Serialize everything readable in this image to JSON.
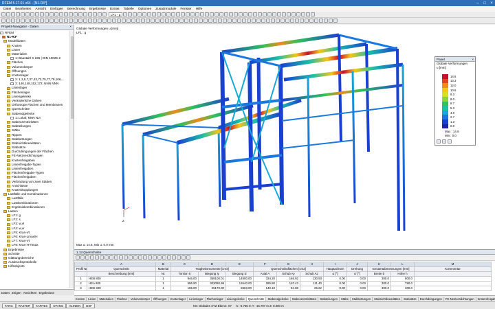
{
  "app": {
    "title": "RFEM 5.17.01 x64 - [N1-R3*]"
  },
  "menu": [
    "Datei",
    "Bearbeiten",
    "Ansicht",
    "Einfügen",
    "Berechnung",
    "Ergebnisse",
    "Extras",
    "Tabelle",
    "Optionen",
    "Zusatzmodule",
    "Fenster",
    "Hilfe"
  ],
  "toolbar": {
    "loadcase_combo": "LF1 - g"
  },
  "navigator": {
    "title": "Projekt-Navigator - Daten",
    "close": "×",
    "root": "RFEM",
    "model": "N1-R3*",
    "items": [
      {
        "label": "Modelldaten",
        "indent": 1,
        "icon": "folder"
      },
      {
        "label": "Knoten",
        "indent": 2,
        "icon": "folder"
      },
      {
        "label": "Linien",
        "indent": 2,
        "icon": "folder"
      },
      {
        "label": "Materialien",
        "indent": 2,
        "icon": "folder"
      },
      {
        "label": "1: Baustahl S 235 | DIN 10025-2",
        "indent": 3,
        "icon": "doc"
      },
      {
        "label": "Flächen",
        "indent": 2,
        "icon": "folder"
      },
      {
        "label": "Volumenkörper",
        "indent": 2,
        "icon": "folder"
      },
      {
        "label": "Öffnungen",
        "indent": 2,
        "icon": "folder"
      },
      {
        "label": "Knotenlager",
        "indent": 2,
        "icon": "folder"
      },
      {
        "label": "2: 1,3,5,7,37,43,73,75,77,79,106,...",
        "indent": 3,
        "icon": "doc"
      },
      {
        "label": "3: 146,148,152,172; NNN NNN",
        "indent": 3,
        "icon": "doc"
      },
      {
        "label": "Linienlager",
        "indent": 2,
        "icon": "folder"
      },
      {
        "label": "Flächenlager",
        "indent": 2,
        "icon": "folder"
      },
      {
        "label": "Liniengelenke",
        "indent": 2,
        "icon": "folder"
      },
      {
        "label": "Veränderliche Dicken",
        "indent": 2,
        "icon": "folder"
      },
      {
        "label": "Orthotrope Flächen und Membranen",
        "indent": 2,
        "icon": "folder"
      },
      {
        "label": "Querschnitte",
        "indent": 2,
        "icon": "folder"
      },
      {
        "label": "Stabendgelenke",
        "indent": 2,
        "icon": "folder"
      },
      {
        "label": "1: Lokal; NNN NJI",
        "indent": 3,
        "icon": "doc"
      },
      {
        "label": "Stabexzentrizitäten",
        "indent": 2,
        "icon": "folder"
      },
      {
        "label": "Stabteilungen",
        "indent": 2,
        "icon": "folder"
      },
      {
        "label": "Stäbe",
        "indent": 2,
        "icon": "folder"
      },
      {
        "label": "Rippen",
        "indent": 2,
        "icon": "folder"
      },
      {
        "label": "Stabbettungen",
        "indent": 2,
        "icon": "folder"
      },
      {
        "label": "Stabnichtlinearitäten",
        "indent": 2,
        "icon": "folder"
      },
      {
        "label": "Stabsätze",
        "indent": 2,
        "icon": "folder"
      },
      {
        "label": "Durchdringungen der Flächen",
        "indent": 2,
        "icon": "folder"
      },
      {
        "label": "FE-Netzverdichtungen",
        "indent": 2,
        "icon": "folder"
      },
      {
        "label": "Knotenfreigaben",
        "indent": 2,
        "icon": "folder"
      },
      {
        "label": "Linienfreigabe-Typen",
        "indent": 2,
        "icon": "folder"
      },
      {
        "label": "Linienfreigaben",
        "indent": 2,
        "icon": "folder"
      },
      {
        "label": "Flächenfreigabe-Typen",
        "indent": 2,
        "icon": "folder"
      },
      {
        "label": "Flächenfreigaben",
        "indent": 2,
        "icon": "folder"
      },
      {
        "label": "Verbindung von zwei Stäben",
        "indent": 2,
        "icon": "folder"
      },
      {
        "label": "Anschlüsse",
        "indent": 2,
        "icon": "folder"
      },
      {
        "label": "Knotenkopplungen",
        "indent": 2,
        "icon": "folder"
      },
      {
        "label": "Lastfälle und Kombinationen",
        "indent": 1,
        "icon": "folder"
      },
      {
        "label": "Lastfälle",
        "indent": 2,
        "icon": "folder"
      },
      {
        "label": "Lastkombinationen",
        "indent": 2,
        "icon": "folder"
      },
      {
        "label": "Ergebniskombinationen",
        "indent": 2,
        "icon": "folder"
      },
      {
        "label": "Lasten",
        "indent": 1,
        "icon": "folder"
      },
      {
        "label": "LF1: g",
        "indent": 2,
        "icon": "folder"
      },
      {
        "label": "LF2: s",
        "indent": 2,
        "icon": "folder"
      },
      {
        "label": "LF3: w,vl",
        "indent": 2,
        "icon": "folder"
      },
      {
        "label": "LF4: w,vr",
        "indent": 2,
        "icon": "folder"
      },
      {
        "label": "LF5: Kran-Vt",
        "indent": 2,
        "icon": "folder"
      },
      {
        "label": "LF6: Kran-Lmax/H",
        "indent": 2,
        "icon": "folder"
      },
      {
        "label": "LF7: Kran-Vt",
        "indent": 2,
        "icon": "folder"
      },
      {
        "label": "LF8: Kran-H-Hmax",
        "indent": 2,
        "icon": "folder"
      },
      {
        "label": "Ergebnisse",
        "indent": 1,
        "icon": "folder"
      },
      {
        "label": "Schnitte",
        "indent": 1,
        "icon": "folder"
      },
      {
        "label": "Glättungsbereiche",
        "indent": 1,
        "icon": "folder"
      },
      {
        "label": "Ausdrucksprotokolle",
        "indent": 1,
        "icon": "folder"
      },
      {
        "label": "Hilfsobjekte",
        "indent": 1,
        "icon": "folder"
      }
    ],
    "tabs": [
      "Daten",
      "Zeigen",
      "Ansichten",
      "Ergebnisse"
    ]
  },
  "view": {
    "info_line1": "Globale Verformungen u [mm]",
    "info_line2": "LF1 : g",
    "footer": "Max u: 14.6, Min u: 0.0 mm",
    "axis_label": "Z"
  },
  "panel": {
    "title": "Panel",
    "close": "×",
    "subtitle": "Globale Verformungen",
    "unit": "u [mm]",
    "legend": [
      {
        "value": "14.6",
        "color": "#c8102e"
      },
      {
        "value": "13.3",
        "color": "#e8401c"
      },
      {
        "value": "12.0",
        "color": "#f08a1c"
      },
      {
        "value": "10.6",
        "color": "#f5c518"
      },
      {
        "value": "9.3",
        "color": "#d8e21a"
      },
      {
        "value": "8.0",
        "color": "#8cd43a"
      },
      {
        "value": "6.7",
        "color": "#2fc25a"
      },
      {
        "value": "5.3",
        "color": "#1cc0a6"
      },
      {
        "value": "4.0",
        "color": "#18a8d8"
      },
      {
        "value": "2.7",
        "color": "#1a78e0"
      },
      {
        "value": "1.3",
        "color": "#1a40d0"
      },
      {
        "value": "0.0",
        "color": "#2020a8"
      }
    ],
    "max_label": "Max :",
    "max_value": "14.6",
    "min_label": "Min :",
    "min_value": "0.0"
  },
  "results": {
    "title": "1.13 Querschnitte",
    "col_letters": [
      "",
      "A",
      "B",
      "C",
      "D",
      "E",
      "F",
      "G",
      "H",
      "I",
      "J",
      "K",
      "L",
      "M"
    ],
    "header1": [
      "Profil Nr.",
      "Querschnitt",
      "Material",
      "Trägheitsmomente [cm4]",
      "",
      "",
      "Querschnittsflächen [cm2]",
      "",
      "",
      "Hauptachsen",
      "Drehung",
      "Gesamtabmessungen [mm]",
      "",
      "Kommentar"
    ],
    "header2": [
      "",
      "Beschreibung [mm]",
      "Nr.",
      "Torsion It",
      "Biegung Iy",
      "Biegung Iz",
      "Axial A",
      "Schub Ay",
      "Schub Az",
      "α [°]",
      "α' [°]",
      "Breite b",
      "Höhe h",
      ""
    ],
    "rows": [
      [
        "1",
        "HEB 800",
        "1",
        "946.00",
        "359100.01",
        "14900.00",
        "334.20",
        "165.92",
        "130.93",
        "0.00",
        "0.00",
        "300.0",
        "800.0",
        ""
      ],
      [
        "2",
        "HEA 800",
        "1",
        "596.90",
        "303090.99",
        "12640.00",
        "285.80",
        "140.43",
        "111.40",
        "0.00",
        "0.00",
        "300.0",
        "790.0",
        ""
      ],
      [
        "3",
        "HEB 300",
        "1",
        "185.00",
        "25170.00",
        "8563.00",
        "149.10",
        "94.98",
        "25.62",
        "0.00",
        "0.00",
        "300.0",
        "300.0",
        ""
      ]
    ]
  },
  "sheet_tabs": [
    "Knoten",
    "Linien",
    "Materialien",
    "Flächen",
    "Volumenkörper",
    "Öffnungen",
    "Knotenlager",
    "Linienlager",
    "Flächenlager",
    "Liniengelenke",
    "Querschnitte",
    "Stabendgelenke",
    "Stabexzentrizitäten",
    "Stabteilungen",
    "Stäbe",
    "Stabbettungen",
    "Stabnichtlinearitäten",
    "Stabsätze",
    "Durchdringungen",
    "FE-Netzverdichtungen",
    "Knotenfreigaben"
  ],
  "active_sheet": "Querschnitte",
  "status": {
    "buttons": [
      "FANG",
      "RASTER",
      "KARTES",
      "OFANG",
      "HLINIEN",
      "DXF"
    ],
    "plane": "KS: Globales XYZ  Ebene: XY",
    "coords": "X: -6.755 m   Y: -16.707 m   Z: 0.000 m"
  }
}
